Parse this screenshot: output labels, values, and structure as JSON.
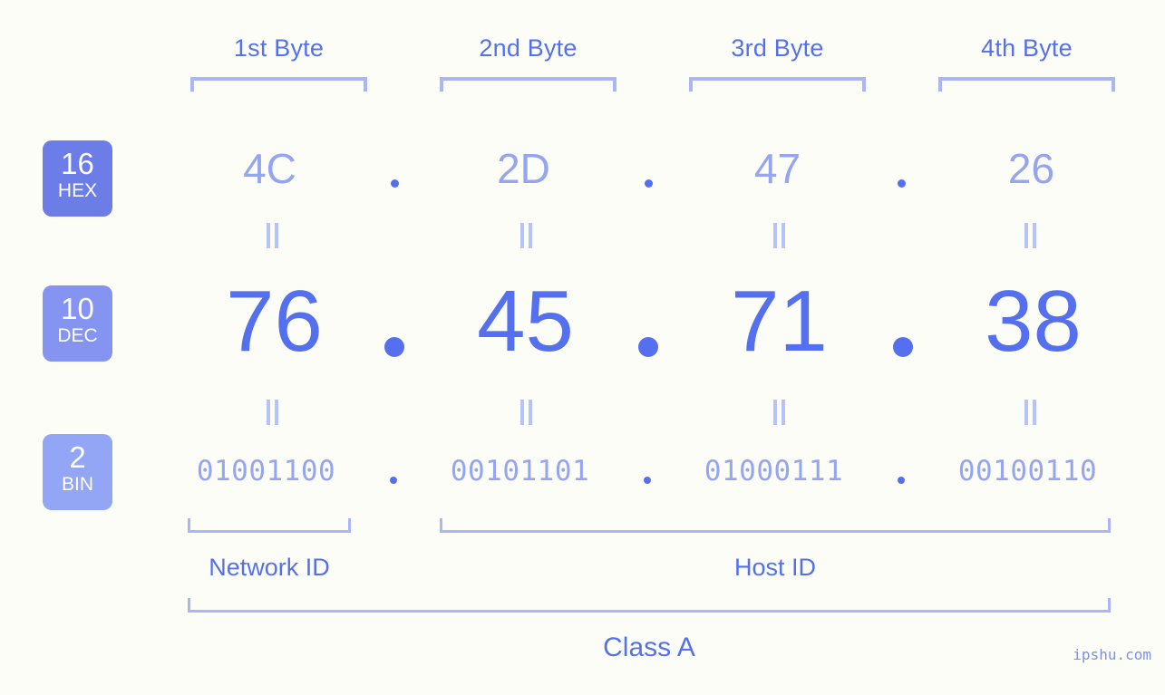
{
  "title": "IP address byte breakdown",
  "background_color": "#fbfdf6",
  "colors": {
    "accent_strong": "#5570ee",
    "accent_light": "#95a5f0",
    "bracket": "#aab6f8",
    "badge_hex": "#6c7de8",
    "badge_dec": "#8494f0",
    "badge_bin": "#93a5f5"
  },
  "byte_headers": [
    {
      "label": "1st Byte"
    },
    {
      "label": "2nd Byte"
    },
    {
      "label": "3rd Byte"
    },
    {
      "label": "4th Byte"
    }
  ],
  "radix_badges": [
    {
      "number": "16",
      "abbr": "HEX"
    },
    {
      "number": "10",
      "abbr": "DEC"
    },
    {
      "number": "2",
      "abbr": "BIN"
    }
  ],
  "rows": {
    "hex": {
      "values": [
        "4C",
        "2D",
        "47",
        "26"
      ],
      "separator": "."
    },
    "dec": {
      "values": [
        "76",
        "45",
        "71",
        "38"
      ],
      "separator": "."
    },
    "bin": {
      "values": [
        "01001100",
        "00101101",
        "01000111",
        "00100110"
      ],
      "separator": "."
    }
  },
  "equals_symbol": "=",
  "segments": [
    {
      "label": "Network ID"
    },
    {
      "label": "Host ID"
    }
  ],
  "class": {
    "label": "Class A"
  },
  "watermark": {
    "text": "ipshu.com"
  }
}
